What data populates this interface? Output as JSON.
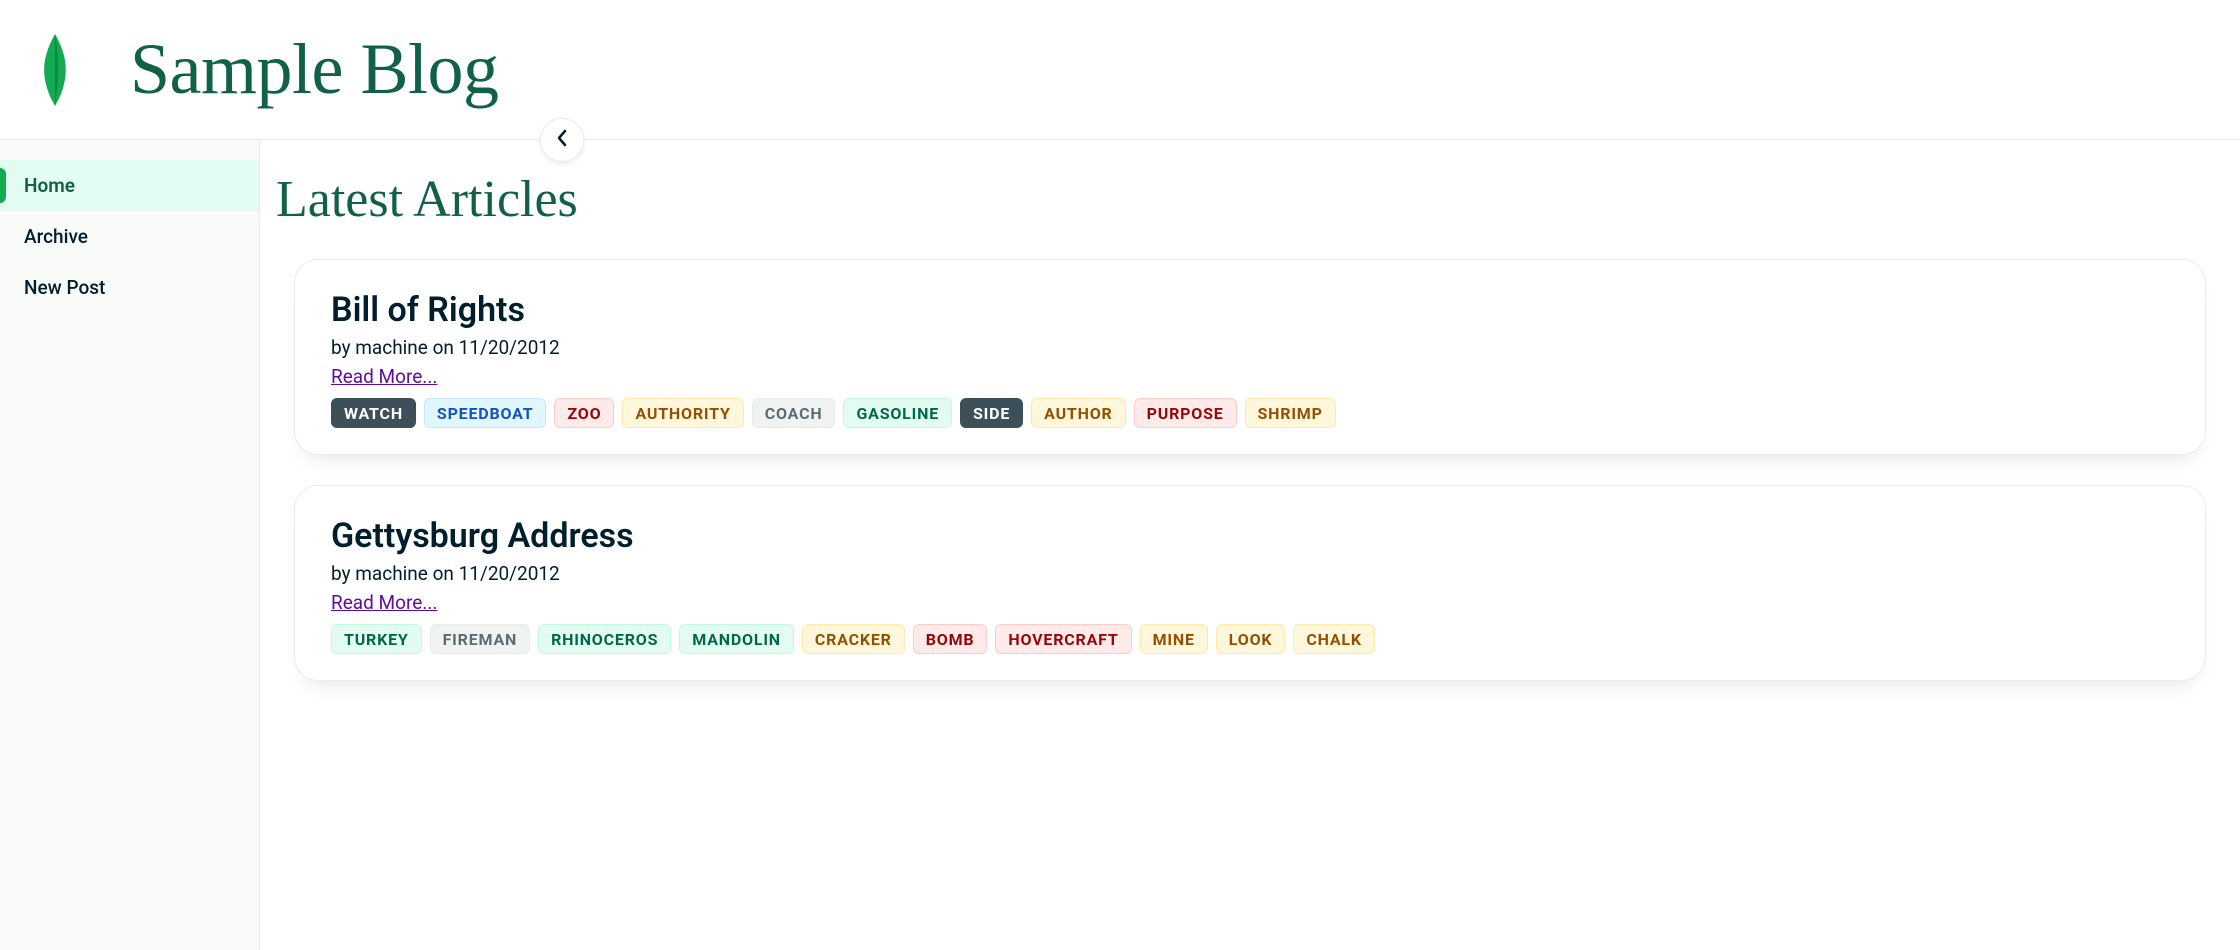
{
  "site": {
    "title": "Sample Blog"
  },
  "sidebar": {
    "items": [
      {
        "label": "Home",
        "active": true
      },
      {
        "label": "Archive",
        "active": false
      },
      {
        "label": "New Post",
        "active": false
      }
    ]
  },
  "page": {
    "title": "Latest Articles",
    "read_more_label": "Read More..."
  },
  "articles": [
    {
      "title": "Bill of Rights",
      "author": "machine",
      "date": "11/20/2012",
      "tags": [
        {
          "label": "WATCH",
          "color": "dark"
        },
        {
          "label": "SPEEDBOAT",
          "color": "blue"
        },
        {
          "label": "ZOO",
          "color": "red"
        },
        {
          "label": "AUTHORITY",
          "color": "yellow"
        },
        {
          "label": "COACH",
          "color": "gray"
        },
        {
          "label": "GASOLINE",
          "color": "green"
        },
        {
          "label": "SIDE",
          "color": "dark"
        },
        {
          "label": "AUTHOR",
          "color": "yellow"
        },
        {
          "label": "PURPOSE",
          "color": "red"
        },
        {
          "label": "SHRIMP",
          "color": "yellow"
        }
      ]
    },
    {
      "title": "Gettysburg Address",
      "author": "machine",
      "date": "11/20/2012",
      "tags": [
        {
          "label": "TURKEY",
          "color": "green"
        },
        {
          "label": "FIREMAN",
          "color": "gray"
        },
        {
          "label": "RHINOCEROS",
          "color": "green"
        },
        {
          "label": "MANDOLIN",
          "color": "green"
        },
        {
          "label": "CRACKER",
          "color": "yellow"
        },
        {
          "label": "BOMB",
          "color": "red"
        },
        {
          "label": "HOVERCRAFT",
          "color": "red"
        },
        {
          "label": "MINE",
          "color": "yellow"
        },
        {
          "label": "LOOK",
          "color": "yellow"
        },
        {
          "label": "CHALK",
          "color": "yellow"
        }
      ]
    }
  ]
}
